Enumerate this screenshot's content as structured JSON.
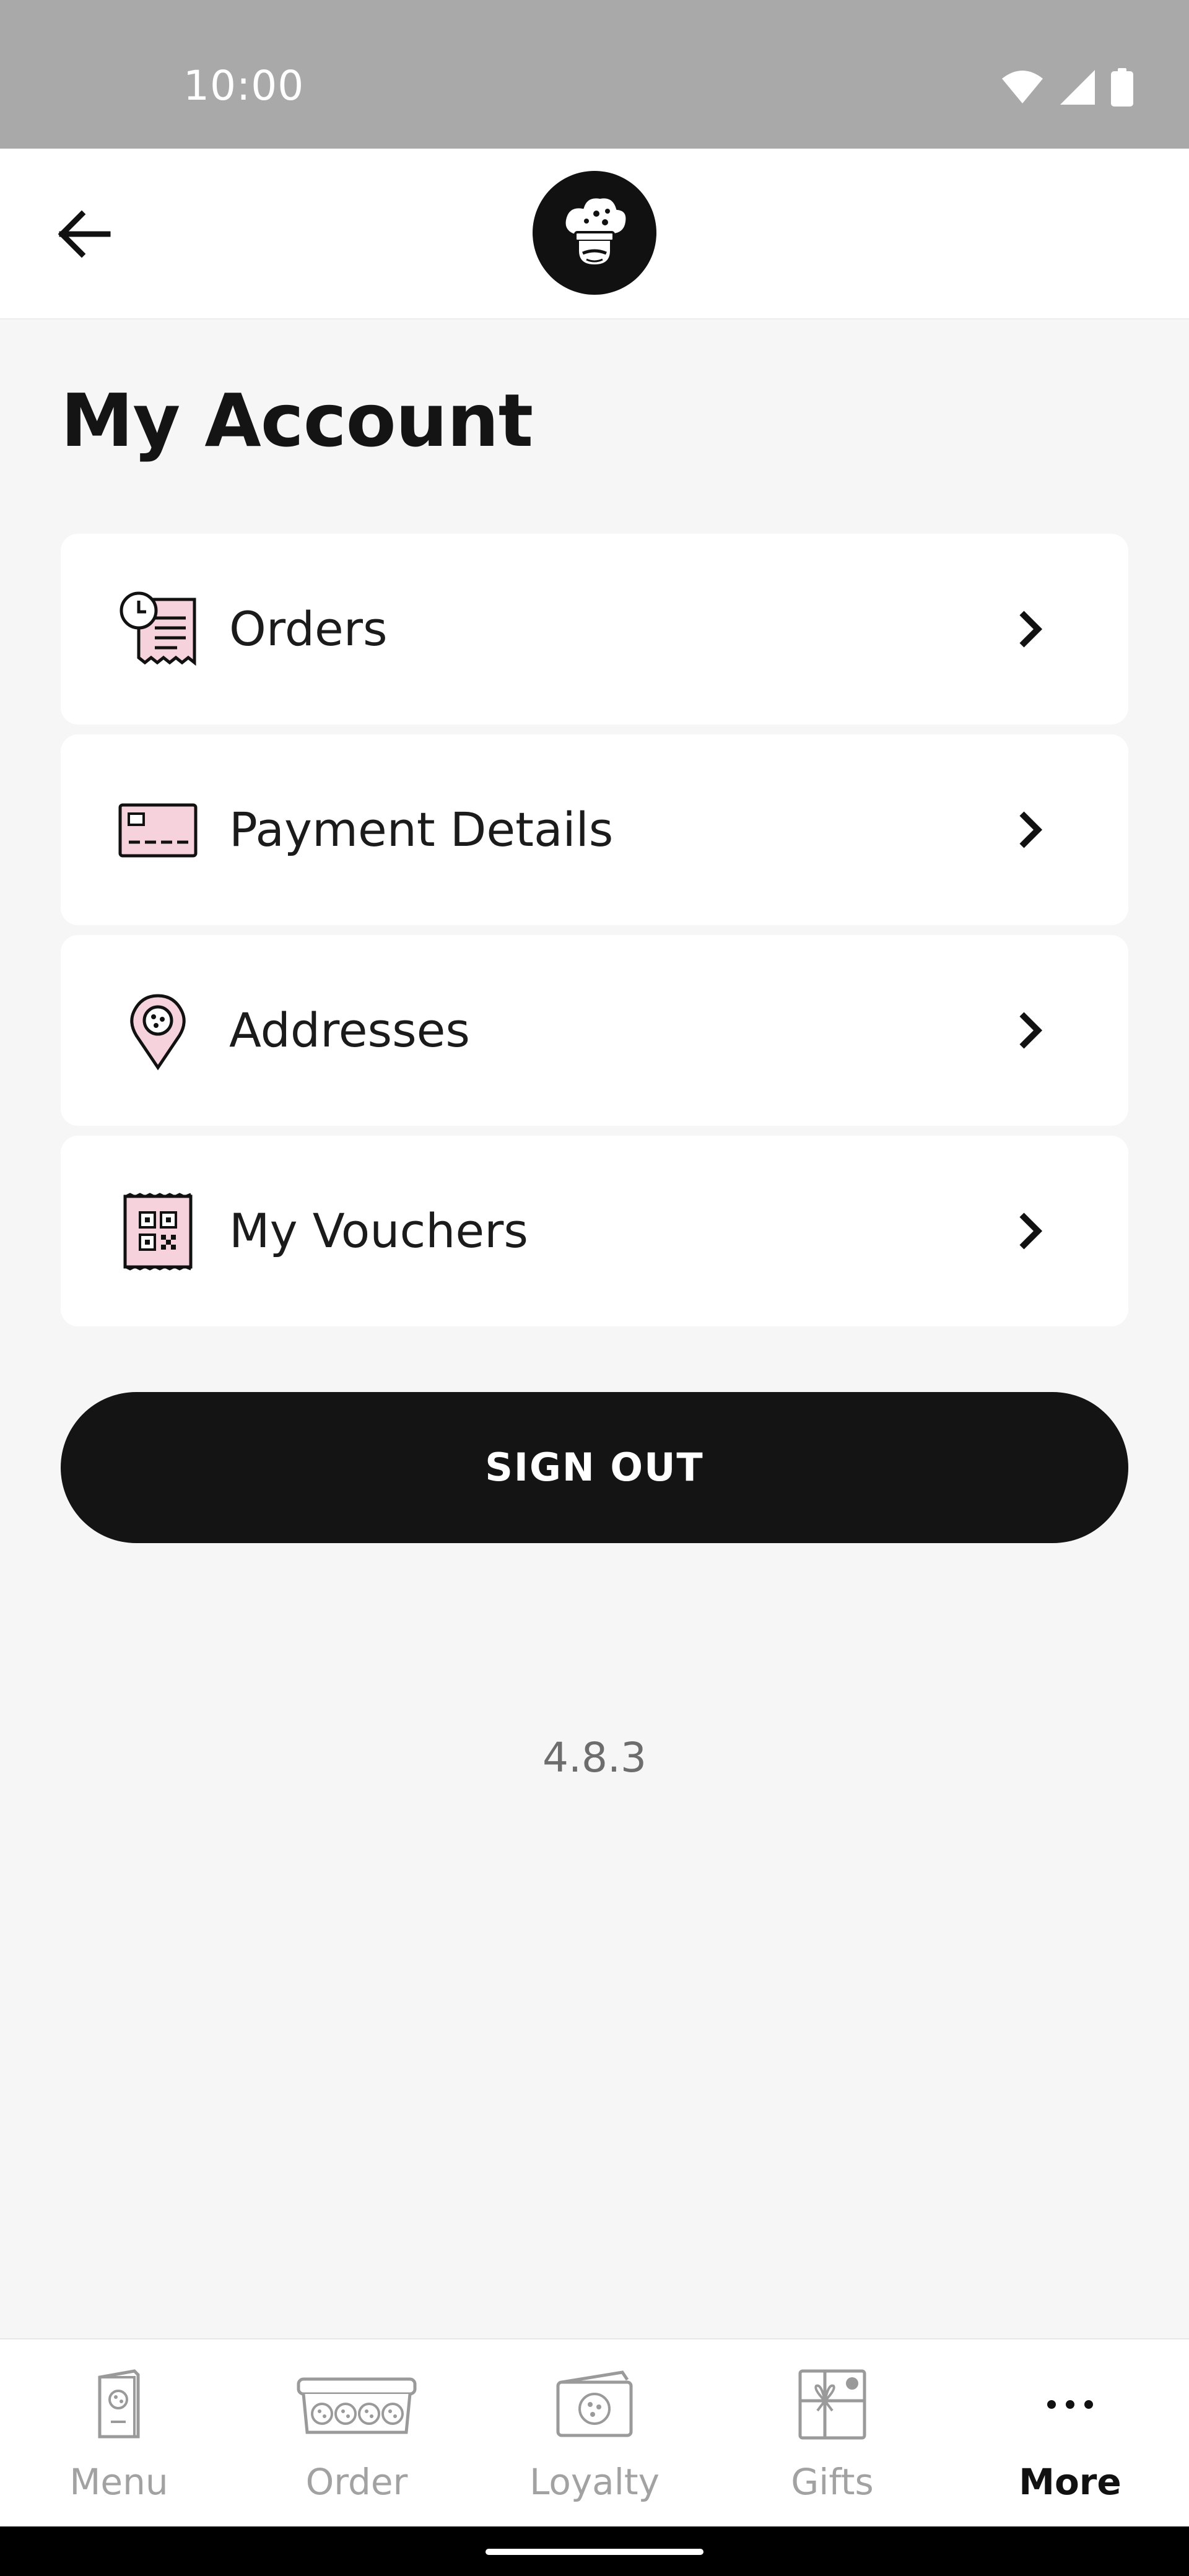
{
  "status_bar": {
    "time": "10:00",
    "icons": [
      "wifi-icon",
      "signal-icon",
      "battery-icon"
    ]
  },
  "app_bar": {
    "back_icon": "arrow-left-icon",
    "logo": "chef-cookie-logo"
  },
  "page": {
    "title": "My Account"
  },
  "menu": {
    "items": [
      {
        "label": "Orders",
        "icon": "receipt-clock-icon"
      },
      {
        "label": "Payment Details",
        "icon": "credit-card-icon"
      },
      {
        "label": "Addresses",
        "icon": "map-pin-icon"
      },
      {
        "label": "My Vouchers",
        "icon": "voucher-qr-icon"
      }
    ]
  },
  "sign_out_label": "SIGN OUT",
  "version": "4.8.3",
  "bottom_nav": {
    "items": [
      {
        "label": "Menu",
        "icon": "menu-card-icon",
        "active": false
      },
      {
        "label": "Order",
        "icon": "cookie-box-icon",
        "active": false
      },
      {
        "label": "Loyalty",
        "icon": "loyalty-card-icon",
        "active": false
      },
      {
        "label": "Gifts",
        "icon": "gift-icon",
        "active": false
      },
      {
        "label": "More",
        "icon": "more-dots-icon",
        "active": true
      }
    ]
  },
  "colors": {
    "accent_pink": "#f6d3dc",
    "dark": "#141414",
    "background": "#f6f6f6"
  }
}
